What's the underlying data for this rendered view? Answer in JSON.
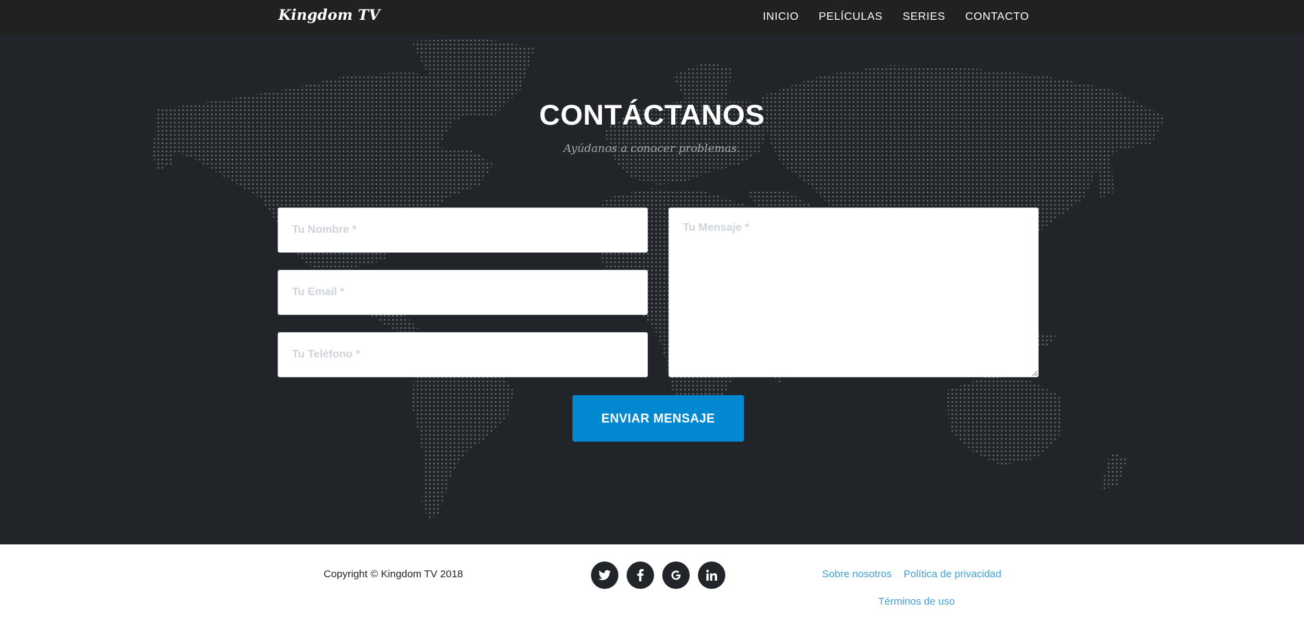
{
  "nav": {
    "brand": "Kingdom TV",
    "links": [
      "INICIO",
      "PELÍCULAS",
      "SERIES",
      "CONTACTO"
    ]
  },
  "contact": {
    "heading": "CONTÁCTANOS",
    "subheading": "Ayúdanos a conocer problemas.",
    "form": {
      "name_placeholder": "Tu Nombre *",
      "email_placeholder": "Tu Email *",
      "phone_placeholder": "Tu Teléfono *",
      "message_placeholder": "Tu Mensaje *",
      "name_value": "",
      "email_value": "",
      "phone_value": "",
      "message_value": "",
      "submit_label": "ENVIAR MENSAJE"
    },
    "background_icon": "world-map-dots"
  },
  "footer": {
    "copyright": "Copyright © Kingdom TV 2018",
    "social": [
      {
        "icon": "twitter-icon"
      },
      {
        "icon": "facebook-icon"
      },
      {
        "icon": "google-icon"
      },
      {
        "icon": "linkedin-icon"
      }
    ],
    "links": {
      "about": "Sobre nosotros",
      "privacy": "Política de privacidad",
      "terms": "Términos de uso"
    }
  },
  "colors": {
    "nav_bg": "#212121",
    "section_bg": "#212529",
    "accent": "#0288d1",
    "link": "#3ea0d8"
  }
}
